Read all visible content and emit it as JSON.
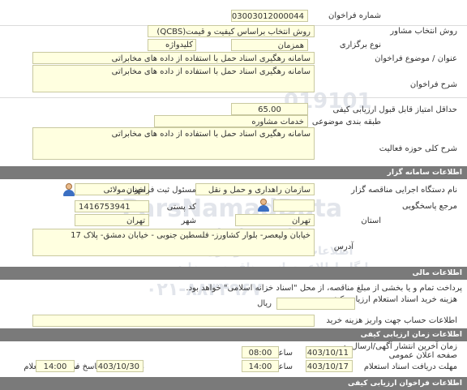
{
  "fields": {
    "tender_number": {
      "label": "شماره فراخوان",
      "value": "2003003012000044"
    },
    "consultant_method": {
      "label": "روش انتخاب مشاور",
      "value": "روش انتخاب براساس کیفیت و قیمت(QCBS)"
    },
    "holding_type": {
      "label": "نوع برگزاری",
      "value": "همزمان"
    },
    "keyword": {
      "label": "کلیدواژه",
      "value": ""
    },
    "subject": {
      "label": "عنوان / موضوع فراخوان",
      "value": "سامانه رهگیری اسناد حمل با استفاده از داده های مخابراتی"
    },
    "description": {
      "label": "شرح فراخوان",
      "value": "سامانه رهگیری اسناد حمل با استفاده از داده های مخابراتی"
    },
    "min_score": {
      "label": "حداقل امتیاز قابل قبول ارزیابی کیفی",
      "value": "65.00"
    },
    "category": {
      "label": "طبقه بندی موضوعی",
      "value": "خدمات مشاوره"
    },
    "activity_scope": {
      "label": "شرح کلی حوزه فعالیت",
      "value": "سامانه رهگیری اسناد حمل با استفاده از داده های مخابراتی"
    }
  },
  "sections": {
    "organizer": "اطلاعات سامانه گزار",
    "financial": "اطلاعات مالی",
    "evaluation_times": "اطلاعات زمان ارزیابی کیفی",
    "evaluation_docs": "اطلاعات فراخوان ارزیابی کیفی"
  },
  "organizer": {
    "executor_label": "نام دستگاه اجرایی مناقصه گزار",
    "executor_value": "سازمان راهداری و حمل و نقل",
    "registrar_label": "مسئول ثبت فراخوان",
    "registrar_value": "مهناز مولائی",
    "responder_label": "مرجع پاسخگویی",
    "responder_value": "",
    "postal_label": "کد پستی",
    "postal_value": "1416753941",
    "province_label": "استان",
    "province_value": "تهران",
    "city_label": "شهر",
    "city_value": "تهران",
    "address_label": "آدرس",
    "address_value": "خیابان ولیعصر- بلوار کشاورز- فلسطین جنوبی - خیابان دمشق- پلاک 17"
  },
  "financial": {
    "payment_note": "پرداخت تمام و یا بخشی از مبلغ مناقصه، از محل \"اسناد خزانه اسلامی\" خواهد بود.",
    "doc_cost_label": "هزینه خرید اسناد استعلام ارزیابی کیفی",
    "doc_cost_unit": "ریال",
    "doc_cost_value": "",
    "account_label": "اطلاعات حساب جهت واریز هزینه خرید",
    "account_value": ""
  },
  "times": {
    "publish_label": "زمان آخرین انتشار آگهی/ارسال به صفحه اعلان عمومی",
    "publish_date": "1403/10/11",
    "publish_time": "08:00",
    "receive_label": "مهلت دریافت اسناد استعلام",
    "receive_date": "1403/10/17",
    "receive_time": "14:00",
    "send_label": "مهلت ارسال پاسخ فراخوان/استعلام",
    "send_date": "1403/10/30",
    "send_time": "14:00",
    "time_label": "ساعت"
  },
  "watermark": {
    "number": "019101",
    "line1": "ParsNamadData",
    "line2": "پارس نماد داده",
    "line3": "اطلاعات مناقصه ها و مزایده ها",
    "line4": "پایگاه اطلاع رسانی مناقصه و مزایده",
    "phone": "۰۲۱-۸۸۳۴۹۶۷۰"
  }
}
